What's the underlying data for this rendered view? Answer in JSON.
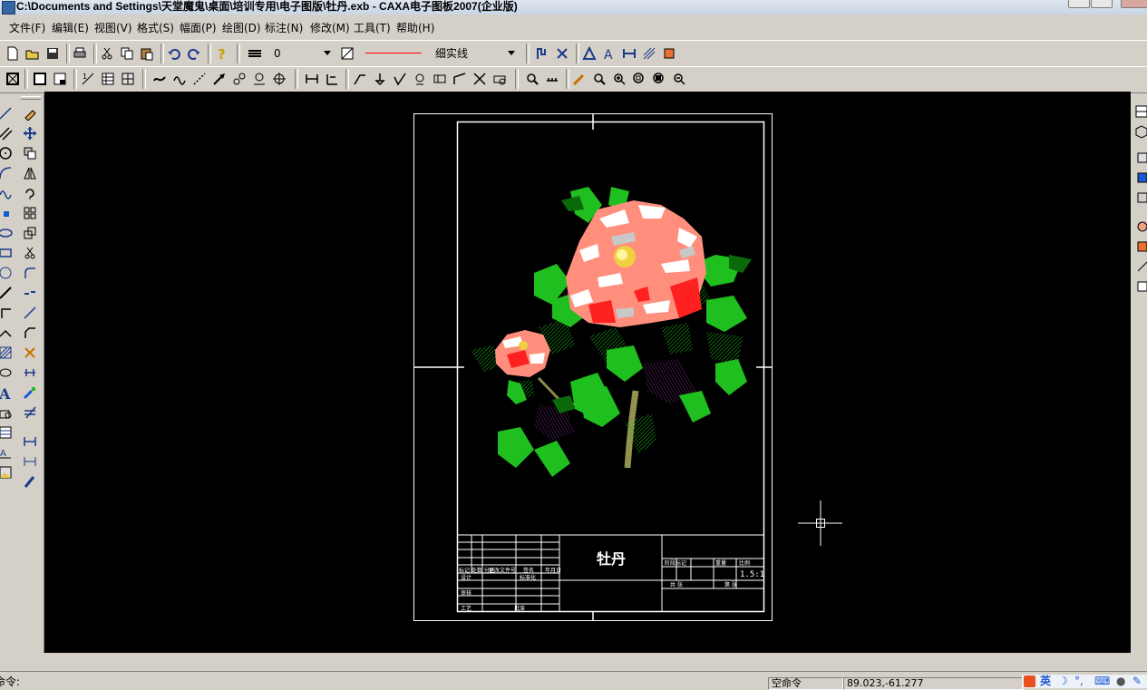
{
  "window": {
    "title": "C:\\Documents and Settings\\天堂魔鬼\\桌面\\培训专用\\电子图版\\牡丹.exb - CAXA电子图板2007(企业版)"
  },
  "menu": [
    "文件(F)",
    "编辑(E)",
    "视图(V)",
    "格式(S)",
    "幅面(P)",
    "绘图(D)",
    "标注(N)",
    "修改(M)",
    "工具(T)",
    "帮助(H)"
  ],
  "toolbar": {
    "layer_value": "0",
    "linetype_label": "细实线",
    "linetype_color": "#ff0000"
  },
  "drawing": {
    "name": "牡丹",
    "scale": "1.5:1",
    "title_block_text": {
      "r1": "标记 处数 分区",
      "r2": "更改文件号",
      "r3": "签名",
      "r4": "年月日",
      "design": "设计",
      "std": "标准化",
      "review": "审核",
      "craft": "工艺",
      "approve": "批准",
      "stage": "阶段标记",
      "weight": "重量",
      "ratio": "比例",
      "sheets": "共 张",
      "sheet": "第 张"
    }
  },
  "status": {
    "command_label": "命令:",
    "mode_label": "空命令",
    "coords": "89.023,-61.277"
  },
  "ime": {
    "lang_label": "英"
  },
  "colors": {
    "canvas_bg": "#000000",
    "frame": "#ffffff",
    "petal": "#ff8e7c",
    "petal_dark": "#ff2020",
    "leaf": "#1fbf1f",
    "leaf_dark": "#0a6a0a",
    "shadow": "#5a1a6a",
    "stem": "#8a8a4a"
  }
}
